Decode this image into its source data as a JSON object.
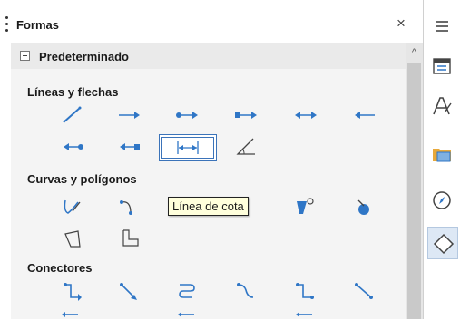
{
  "deck": {
    "title": "Formas",
    "close_glyph": "×"
  },
  "panel": {
    "title": "Predeterminado",
    "scroll_up_glyph": "^"
  },
  "categories": [
    {
      "label": "Líneas y flechas"
    },
    {
      "label": "Curvas y polígonos"
    },
    {
      "label": "Conectores"
    }
  ],
  "tooltip": {
    "text": "Línea de cota"
  },
  "selected_shape": "dimension-line",
  "sidebar_tabs": [
    {
      "icon": "menu-icon",
      "active": false
    },
    {
      "icon": "properties-icon",
      "active": false
    },
    {
      "icon": "styles-icon",
      "active": false
    },
    {
      "icon": "gallery-icon",
      "active": false
    },
    {
      "icon": "navigator-icon",
      "active": false
    },
    {
      "icon": "shapes-icon",
      "active": true
    }
  ],
  "colors": {
    "accent": "#3b73b9",
    "icon_blue": "#2f76c6",
    "tooltip_bg": "#ffffdc",
    "panel_bg": "#f4f4f4"
  }
}
